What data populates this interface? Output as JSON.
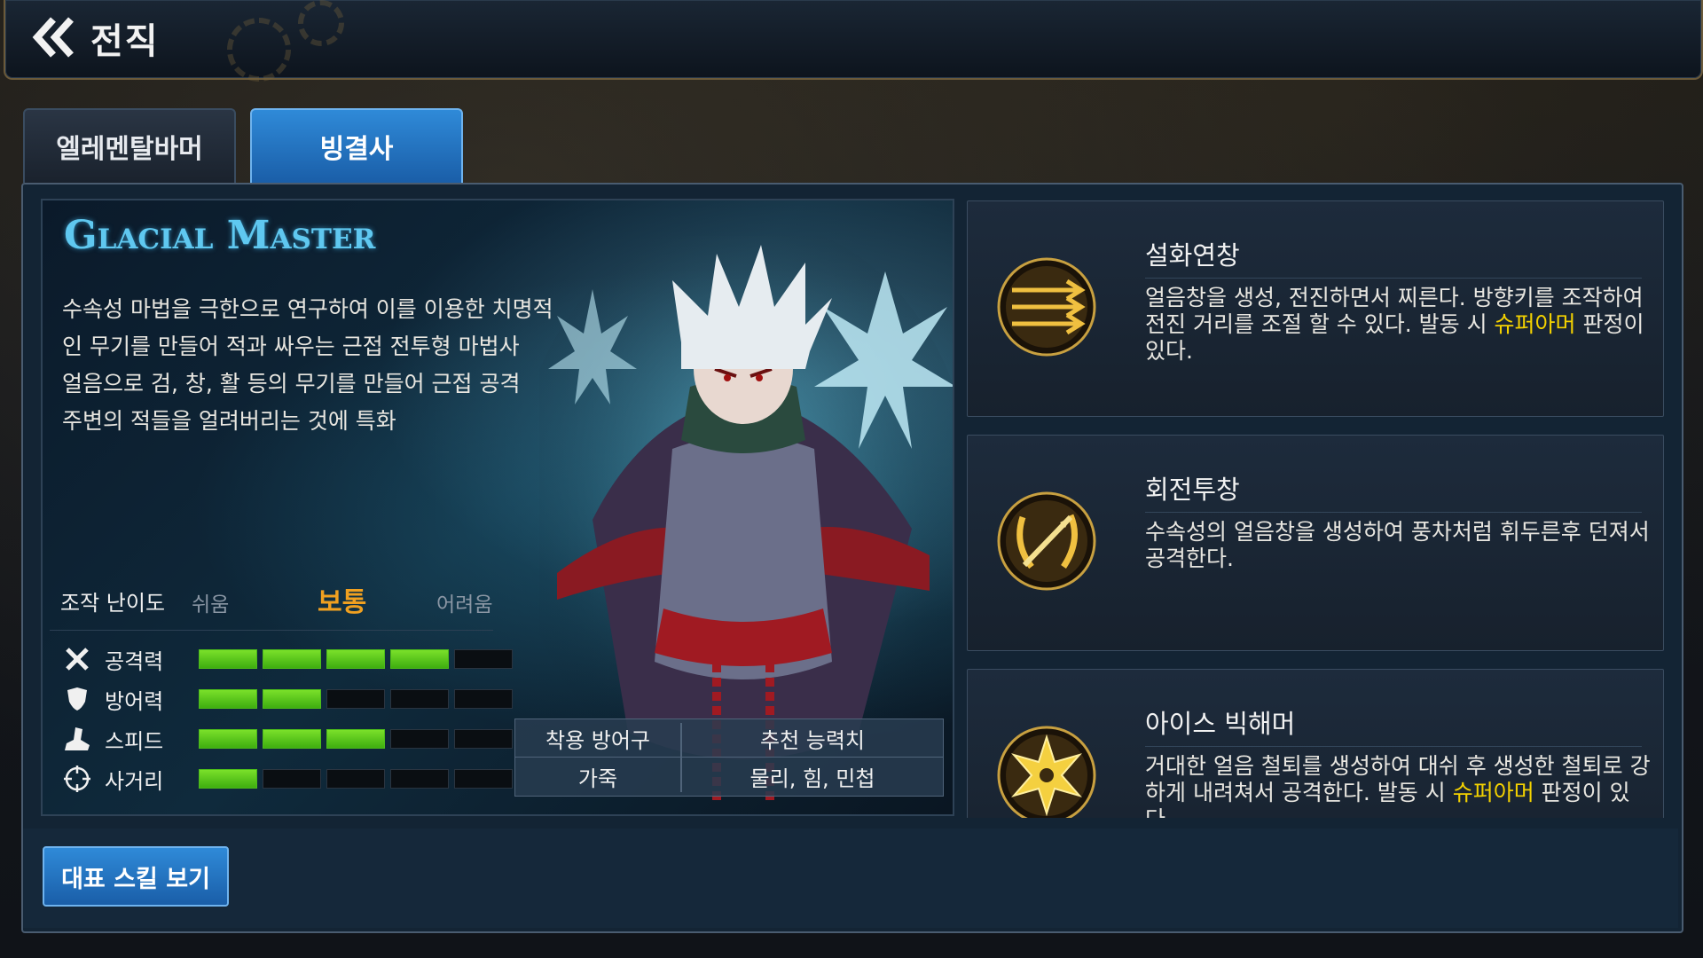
{
  "header": {
    "title": "전직",
    "back_icon": "double-chevron-left-icon"
  },
  "tabs": [
    {
      "label": "엘레멘탈바머",
      "active": false
    },
    {
      "label": "빙결사",
      "active": true
    }
  ],
  "class_info": {
    "title": "Glacial Master",
    "description": [
      "수속성 마법을 극한으로 연구하여 이를 이용한 치명적",
      "인 무기를 만들어 적과 싸우는 근접 전투형 마법사",
      "얼음으로 검, 창, 활 등의 무기를 만들어 근접 공격",
      "주변의 적들을 얼려버리는 것에 특화"
    ],
    "difficulty": {
      "label": "조작 난이도",
      "easy": "쉬움",
      "normal": "보통",
      "hard": "어려움",
      "selected": "normal"
    },
    "stats": [
      {
        "name": "공격력",
        "icon": "crossed-swords-icon",
        "level": 4,
        "max": 5
      },
      {
        "name": "방어력",
        "icon": "shield-icon",
        "level": 2,
        "max": 5
      },
      {
        "name": "스피드",
        "icon": "boot-icon",
        "level": 3,
        "max": 5
      },
      {
        "name": "사거리",
        "icon": "crosshair-icon",
        "level": 1,
        "max": 5
      }
    ],
    "equipment": {
      "armor_header": "착용 방어구",
      "stat_header": "추천 능력치",
      "armor_value": "가죽",
      "stat_value": "물리, 힘, 민첩"
    }
  },
  "skills": [
    {
      "name": "설화연창",
      "icon": "multi-spear-icon",
      "desc_before": "얼음창을 생성, 전진하면서 찌른다. 방향키를 조작하여 전진 거리를 조절 할 수 있다. 발동 시 ",
      "desc_highlight": "슈퍼아머",
      "desc_after": " 판정이 있다."
    },
    {
      "name": "회전투창",
      "icon": "spinning-spear-icon",
      "desc_before": "수속성의 얼음창을 생성하여 풍차처럼 휘두른후 던져서 공격한다.",
      "desc_highlight": "",
      "desc_after": ""
    },
    {
      "name": "아이스 빅해머",
      "icon": "ice-crystal-icon",
      "desc_before": "거대한 얼음 철퇴를 생성하여 대쉬 후 생성한 철퇴로 강하게 내려쳐서 공격한다. 발동 시 ",
      "desc_highlight": "슈퍼아머",
      "desc_after": " 판정이 있다."
    }
  ],
  "footer": {
    "show_skill_button": "대표 스킬 보기"
  },
  "colors": {
    "accent_blue": "#2f8ad8",
    "stat_green": "#5cc81e",
    "difficulty_selected": "#f0a020",
    "highlight_yellow": "#f4d200",
    "title_cyan": "#5fc8f0"
  }
}
